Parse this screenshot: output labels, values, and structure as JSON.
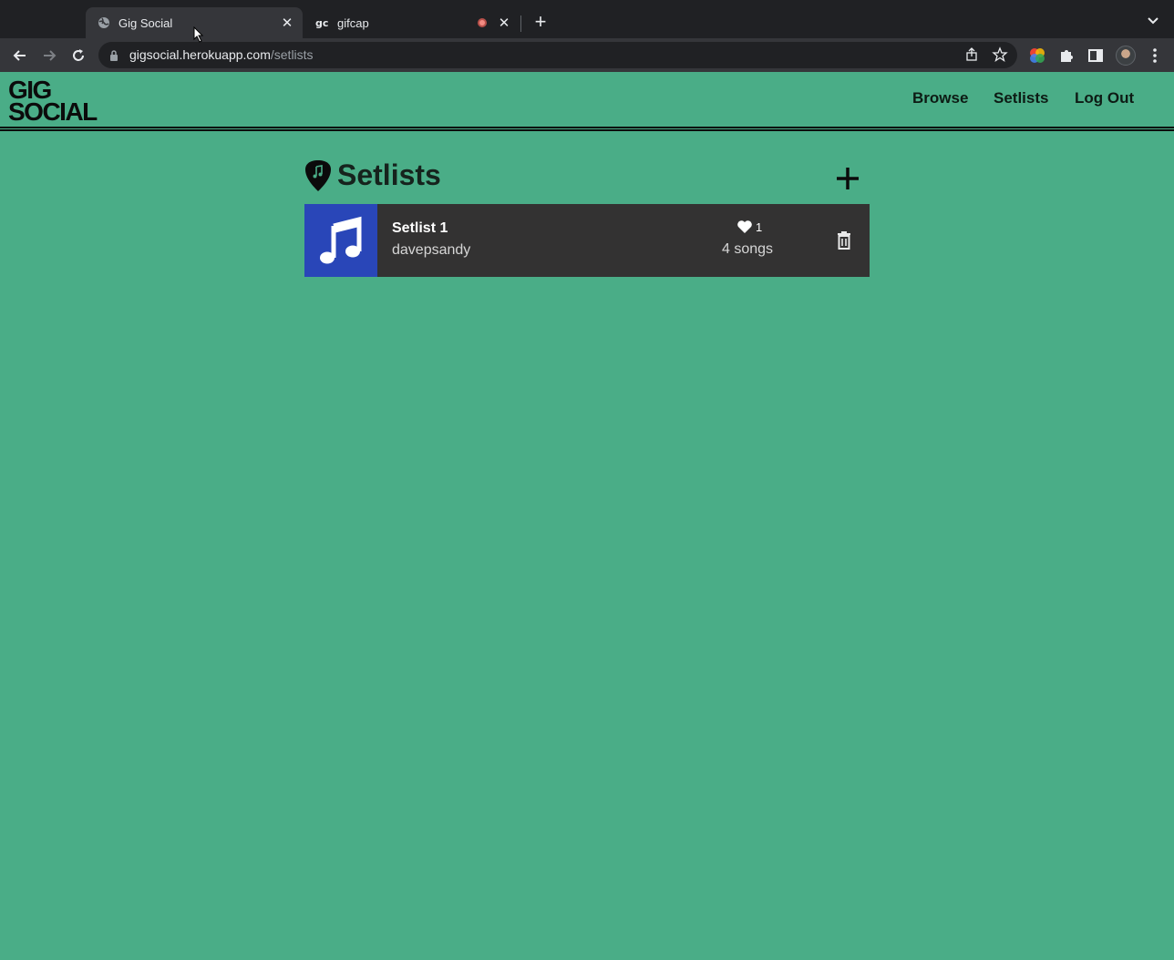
{
  "browser": {
    "tabs": [
      {
        "title": "Gig Social",
        "active": true,
        "favicon": "globe-icon"
      },
      {
        "title": "gifcap",
        "active": false,
        "favicon": "gc-icon",
        "recording": true
      }
    ],
    "url": {
      "host": "gigsocial.herokuapp.com",
      "path": "/setlists"
    }
  },
  "site": {
    "logo": {
      "line1": "GIG",
      "line2": "SOCIAL"
    },
    "nav": [
      "Browse",
      "Setlists",
      "Log Out"
    ]
  },
  "main": {
    "title": "Setlists",
    "setlists": [
      {
        "name": "Setlist 1",
        "owner": "davepsandy",
        "likes": "1",
        "songs": "4 songs"
      }
    ]
  },
  "colors": {
    "page_bg": "#4aad87",
    "card_bg": "#333232",
    "thumb_bg": "#2946b8"
  }
}
